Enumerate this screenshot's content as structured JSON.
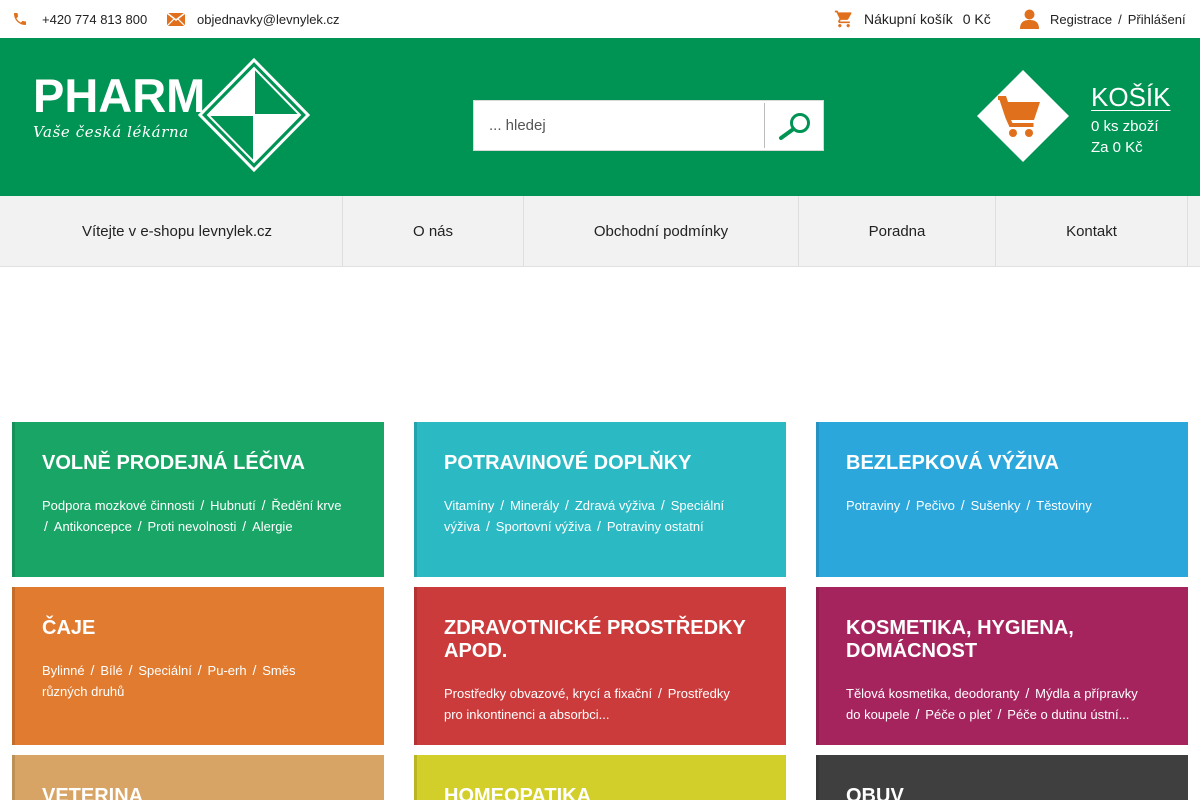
{
  "topbar": {
    "phone": "+420 774 813 800",
    "email": "objednavky@levnylek.cz",
    "cart_label": "Nákupní košík",
    "cart_price": "0 Kč",
    "register": "Registrace",
    "separator": "/",
    "login": "Přihlášení",
    "icons": [
      "phone-icon",
      "mail-icon",
      "cart-icon",
      "user-icon"
    ],
    "icon_color": "#e0701c"
  },
  "header": {
    "logo_word": "PHARM",
    "logo_tagline": "Vaše česká lékárna",
    "search_placeholder": "... hledej",
    "cart_title": "KOŠÍK",
    "cart_items": "0 ks zboží",
    "cart_total": "Za 0 Kč",
    "bg_color": "#009454",
    "accent_color": "#e0701c"
  },
  "nav": {
    "items": [
      {
        "label": "Vítejte v e-shopu levnylek.cz"
      },
      {
        "label": "O nás"
      },
      {
        "label": "Obchodní podmínky"
      },
      {
        "label": "Poradna"
      },
      {
        "label": "Kontakt"
      }
    ]
  },
  "categories": [
    {
      "title": "VOLNĚ PRODEJNÁ LÉČIVA",
      "color": "#18a566",
      "subs": [
        "Podpora mozkové činnosti",
        "Hubnutí",
        "Ředění krve",
        "Antikoncepce",
        "Proti nevolnosti",
        "Alergie"
      ]
    },
    {
      "title": "POTRAVINOVÉ DOPLŇKY",
      "color": "#2bbac4",
      "subs": [
        "Vitamíny",
        "Minerály",
        "Zdravá výživa",
        "Speciální výživa",
        "Sportovní výživa",
        "Potraviny ostatní"
      ]
    },
    {
      "title": "BEZLEPKOVÁ VÝŽIVA",
      "color": "#2ba7dc",
      "subs": [
        "Potraviny",
        "Pečivo",
        "Sušenky",
        "Těstoviny"
      ]
    },
    {
      "title": "ČAJE",
      "color": "#e07b30",
      "subs": [
        "Bylinné",
        "Bílé",
        "Speciální",
        "Pu-erh",
        "Směs různých druhů"
      ]
    },
    {
      "title": "ZDRAVOTNICKÉ PROSTŘEDKY APOD.",
      "color": "#cc3b3b",
      "subs": [
        "Prostředky obvazové, krycí a fixační",
        "Prostředky pro inkontinenci a absorbci..."
      ]
    },
    {
      "title": "KOSMETIKA, HYGIENA, DOMÁCNOST",
      "color": "#a6245e",
      "subs": [
        "Tělová kosmetika, deodoranty",
        "Mýdla a přípravky do koupele",
        "Péče o pleť",
        "Péče o dutinu ústní..."
      ]
    },
    {
      "title": "VETERINA",
      "color": "#d8a465",
      "subs": []
    },
    {
      "title": "HOMEOPATIKA",
      "color": "#d3cf2a",
      "subs": []
    },
    {
      "title": "OBUV",
      "color": "#3f3f3f",
      "subs": []
    }
  ]
}
